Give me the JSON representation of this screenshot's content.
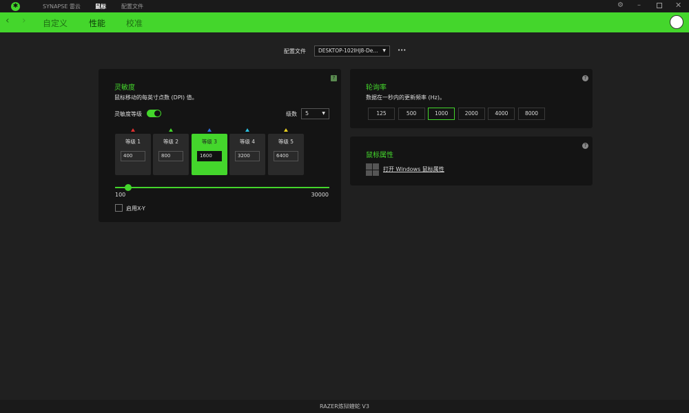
{
  "titlebar": {
    "nav": [
      "SYNAPSE 雷云",
      "鼠标",
      "配置文件"
    ],
    "active": 1
  },
  "navbar": {
    "tabs": [
      "自定义",
      "性能",
      "校准"
    ],
    "active": 1
  },
  "profile": {
    "label": "配置文件",
    "value": "DESKTOP-102IHJ8-De...",
    "more": "•••"
  },
  "sensitivity": {
    "title": "灵敏度",
    "desc": "鼠标移动的每英寸点数 (DPI) 值。",
    "stages_label": "灵敏度等级",
    "stages_enabled": true,
    "count_label": "级数",
    "count_value": "5",
    "stages": [
      {
        "label": "等级 1",
        "value": "400",
        "color": "#e03030"
      },
      {
        "label": "等级 2",
        "value": "800",
        "color": "#44d62c"
      },
      {
        "label": "等级 3",
        "value": "1600",
        "color": "#2f6fe0"
      },
      {
        "label": "等级 4",
        "value": "3200",
        "color": "#2bc0e0"
      },
      {
        "label": "等级 5",
        "value": "6400",
        "color": "#e8d020"
      }
    ],
    "active_stage": 2,
    "slider_min": "100",
    "slider_max": "30000",
    "slider_value": 1600,
    "xy_label": "启用X-Y",
    "xy_checked": false
  },
  "polling": {
    "title": "轮询率",
    "desc": "数据在一秒内的更新频率 (Hz)。",
    "rates": [
      "125",
      "500",
      "1000",
      "2000",
      "4000",
      "8000"
    ],
    "selected": "1000"
  },
  "mouse_props": {
    "title": "鼠标属性",
    "link": "打开 Windows 鼠标属性"
  },
  "footer": {
    "device": "RAZER炼狱蝰蛇 V3"
  },
  "colors": {
    "accent": "#44d62c"
  }
}
